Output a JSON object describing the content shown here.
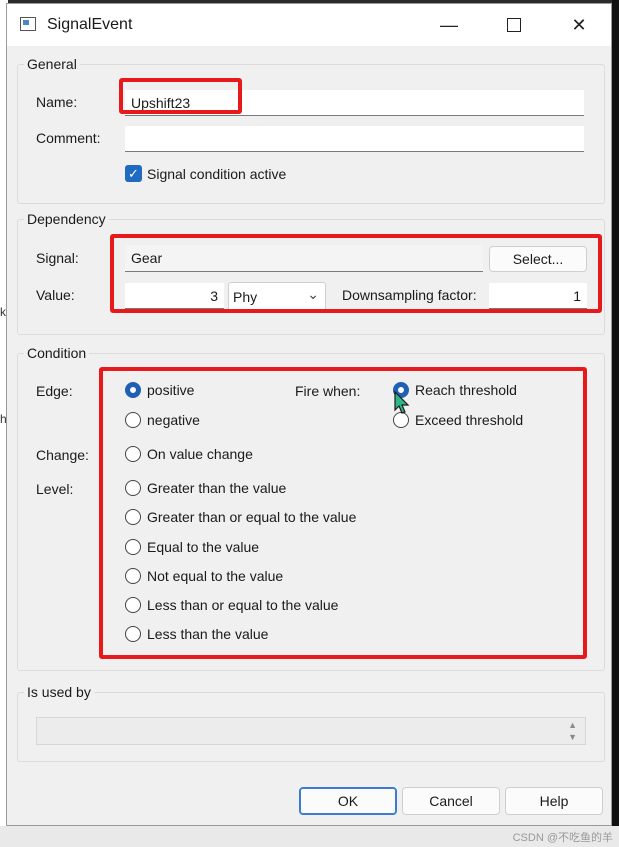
{
  "window": {
    "title": "SignalEvent"
  },
  "general": {
    "legend": "General",
    "name_label": "Name:",
    "name_value": "Upshift23",
    "comment_label": "Comment:",
    "comment_value": "",
    "active_label": "Signal condition active",
    "active_checked": true
  },
  "dependency": {
    "legend": "Dependency",
    "signal_label": "Signal:",
    "signal_value": "Gear",
    "select_button": "Select...",
    "value_label": "Value:",
    "value_value": "3",
    "unit_value": "Phy",
    "downsampling_label": "Downsampling factor:",
    "downsampling_value": "1"
  },
  "condition": {
    "legend": "Condition",
    "edge_label": "Edge:",
    "edge_options": [
      "positive",
      "negative"
    ],
    "edge_selected": "positive",
    "fire_label": "Fire when:",
    "fire_options": [
      "Reach threshold",
      "Exceed threshold"
    ],
    "fire_selected": "Reach threshold",
    "change_label": "Change:",
    "change_option": "On value change",
    "level_label": "Level:",
    "level_options": [
      "Greater than the value",
      "Greater than or equal to the value",
      "Equal to the value",
      "Not equal to the value",
      "Less than or equal to the value",
      "Less than the value"
    ]
  },
  "used_by": {
    "legend": "Is used by"
  },
  "buttons": {
    "ok": "OK",
    "cancel": "Cancel",
    "help": "Help"
  },
  "background": {
    "fragments": [
      "ks",
      "h"
    ]
  },
  "watermark": "CSDN @不吃鱼的羊",
  "colors": {
    "accent": "#1f6bc2",
    "highlight": "#e8191a"
  }
}
